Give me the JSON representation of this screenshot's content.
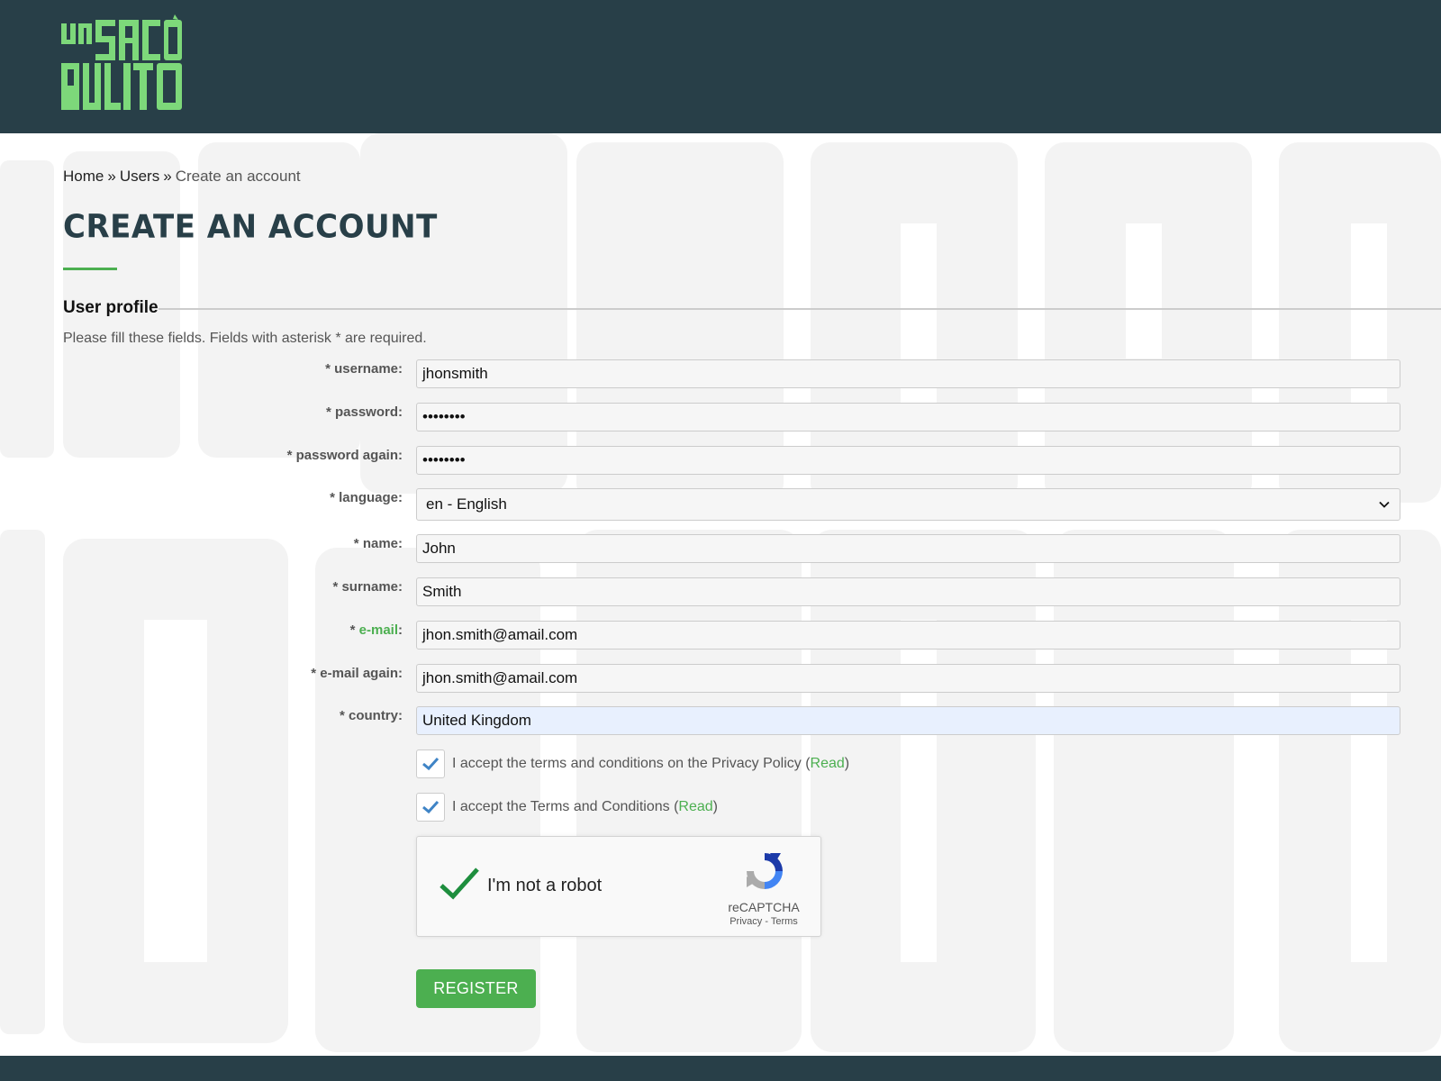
{
  "logo": {
    "text": "UN SACO PULITO",
    "color": "#7dd87a"
  },
  "breadcrumb": {
    "items": [
      "Home",
      "Users"
    ],
    "separator": "»",
    "current": "Create an account"
  },
  "page": {
    "title": "CREATE AN ACCOUNT",
    "section_title": "User profile",
    "instructions": "Please fill these fields. Fields with asterisk * are required."
  },
  "form": {
    "username": {
      "label_prefix": "* ",
      "label": "username",
      "label_suffix": ":",
      "value": "jhonsmith"
    },
    "password": {
      "label_prefix": "* ",
      "label": "password",
      "label_suffix": ":",
      "value": "••••••••"
    },
    "password_again": {
      "label_prefix": "* ",
      "label": "password again",
      "label_suffix": ":",
      "value": "••••••••"
    },
    "language": {
      "label_prefix": "* ",
      "label": "language",
      "label_suffix": ":",
      "value": "en - English"
    },
    "name": {
      "label_prefix": "* ",
      "label": "name",
      "label_suffix": ":",
      "value": "John"
    },
    "surname": {
      "label_prefix": "* ",
      "label": "surname",
      "label_suffix": ":",
      "value": "Smith"
    },
    "email": {
      "label_prefix": "* ",
      "label": "e-mail",
      "label_suffix": ":",
      "value": "jhon.smith@amail.com"
    },
    "email_again": {
      "label_prefix": "* ",
      "label": "e-mail again",
      "label_suffix": ":",
      "value": "jhon.smith@amail.com"
    },
    "country": {
      "label_prefix": "* ",
      "label": "country",
      "label_suffix": ":",
      "value": "United Kingdom"
    }
  },
  "consents": {
    "privacy": {
      "text": "I accept the terms and conditions on the Privacy Policy (",
      "link": "Read",
      "close": ")",
      "checked": true
    },
    "terms": {
      "text": "I accept the Terms and Conditions (",
      "link": "Read",
      "close": ")",
      "checked": true
    }
  },
  "captcha": {
    "label": "I'm not a robot",
    "brand": "reCAPTCHA",
    "privacy": "Privacy",
    "dash": " - ",
    "terms": "Terms",
    "checked": true
  },
  "actions": {
    "register": "REGISTER"
  },
  "colors": {
    "header": "#283f48",
    "accent": "#4caf50",
    "title": "#283f48"
  }
}
